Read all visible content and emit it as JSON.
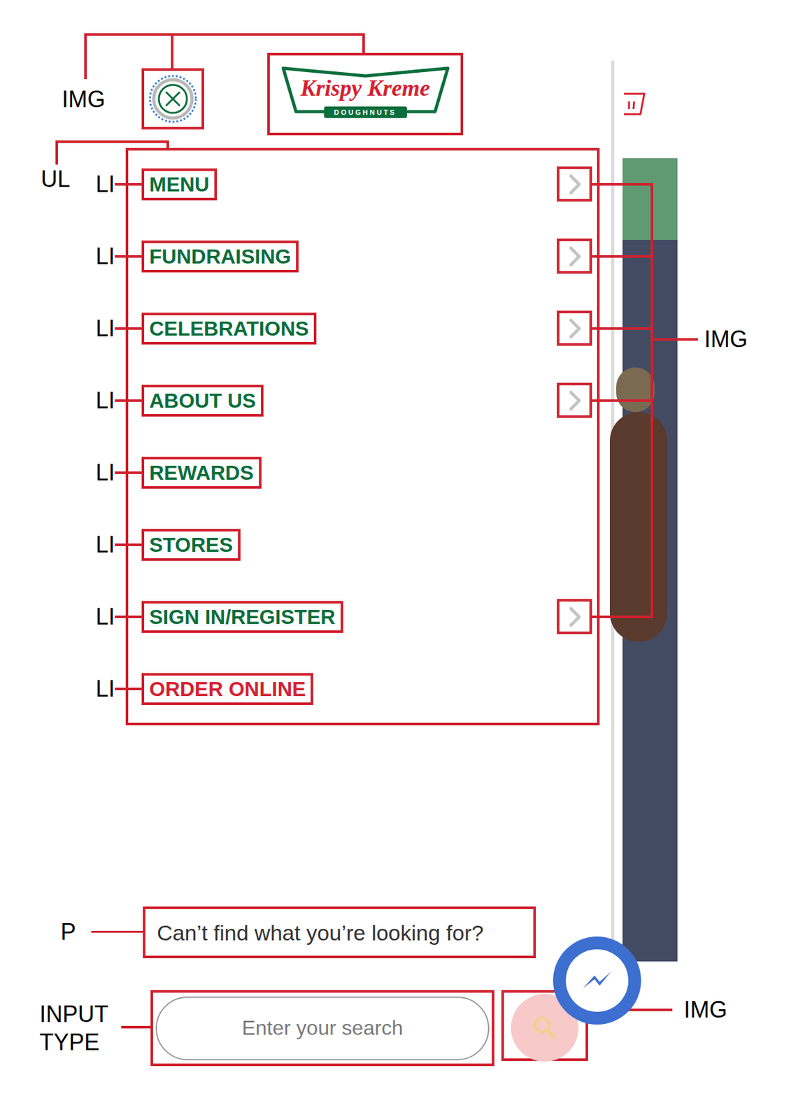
{
  "logo": {
    "script": "Krispy Kreme",
    "tagline": "DOUGHNUTS"
  },
  "annotations": {
    "close_img": "IMG",
    "list": "UL",
    "arrow_img": "IMG",
    "paragraph": "P",
    "input": "INPUT TYPE",
    "search_img": "IMG"
  },
  "menu": [
    {
      "label": "MENU",
      "annotation": "LI",
      "has_arrow": true,
      "color": "#0b6e3c"
    },
    {
      "label": "FUNDRAISING",
      "annotation": "LI",
      "has_arrow": true,
      "color": "#0b6e3c"
    },
    {
      "label": "CELEBRATIONS",
      "annotation": "LI",
      "has_arrow": true,
      "color": "#0b6e3c"
    },
    {
      "label": "ABOUT US",
      "annotation": "LI",
      "has_arrow": true,
      "color": "#0b6e3c"
    },
    {
      "label": "REWARDS",
      "annotation": "LI",
      "has_arrow": false,
      "color": "#0b6e3c"
    },
    {
      "label": "STORES",
      "annotation": "LI",
      "has_arrow": false,
      "color": "#0b6e3c"
    },
    {
      "label": "SIGN IN/REGISTER",
      "annotation": "LI",
      "has_arrow": true,
      "color": "#0b6e3c"
    },
    {
      "label": "ORDER ONLINE",
      "annotation": "LI",
      "has_arrow": false,
      "color": "#d6202f"
    }
  ],
  "prompt": "Can’t find what you’re looking for?",
  "search": {
    "placeholder": "Enter your search"
  }
}
